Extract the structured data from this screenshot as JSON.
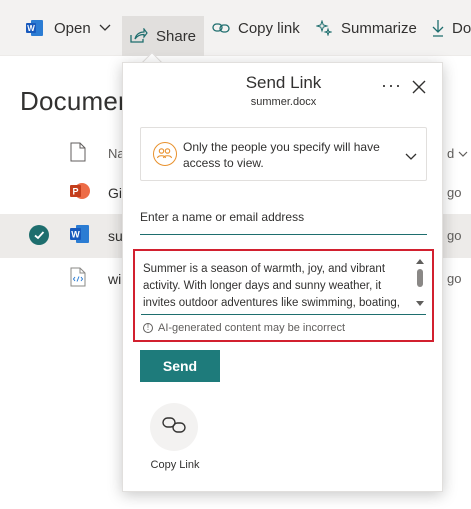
{
  "toolbar": {
    "open_label": "Open",
    "share_label": "Share",
    "copy_link_label": "Copy link",
    "summarize_label": "Summarize",
    "download_label": "Dow"
  },
  "library": {
    "title": "Documer",
    "header": {
      "name_col": "Na",
      "right_col": "d"
    },
    "rows": [
      {
        "name": "Gi",
        "right": "go",
        "type": "powerpoint"
      },
      {
        "name": "su",
        "right": "go",
        "type": "word",
        "selected": true
      },
      {
        "name": "wi",
        "right": "go",
        "type": "code"
      }
    ]
  },
  "dialog": {
    "title": "Send Link",
    "filename": "summer.docx",
    "more_label": "···",
    "permission_text": "Only the people you specify will have access to view.",
    "name_placeholder": "Enter a name or email address",
    "message": "Summer is a season of warmth, joy, and vibrant activity. With longer days and sunny weather, it invites outdoor adventures like swimming, boating, and fishing. Fresh fruits and vegetables abound",
    "ai_note": "AI-generated content may be incorrect",
    "send_label": "Send",
    "copy_link_label": "Copy Link"
  },
  "colors": {
    "accent": "#1e7b7b",
    "highlight_border": "#d2202f",
    "permission_icon": "#e8912d"
  }
}
